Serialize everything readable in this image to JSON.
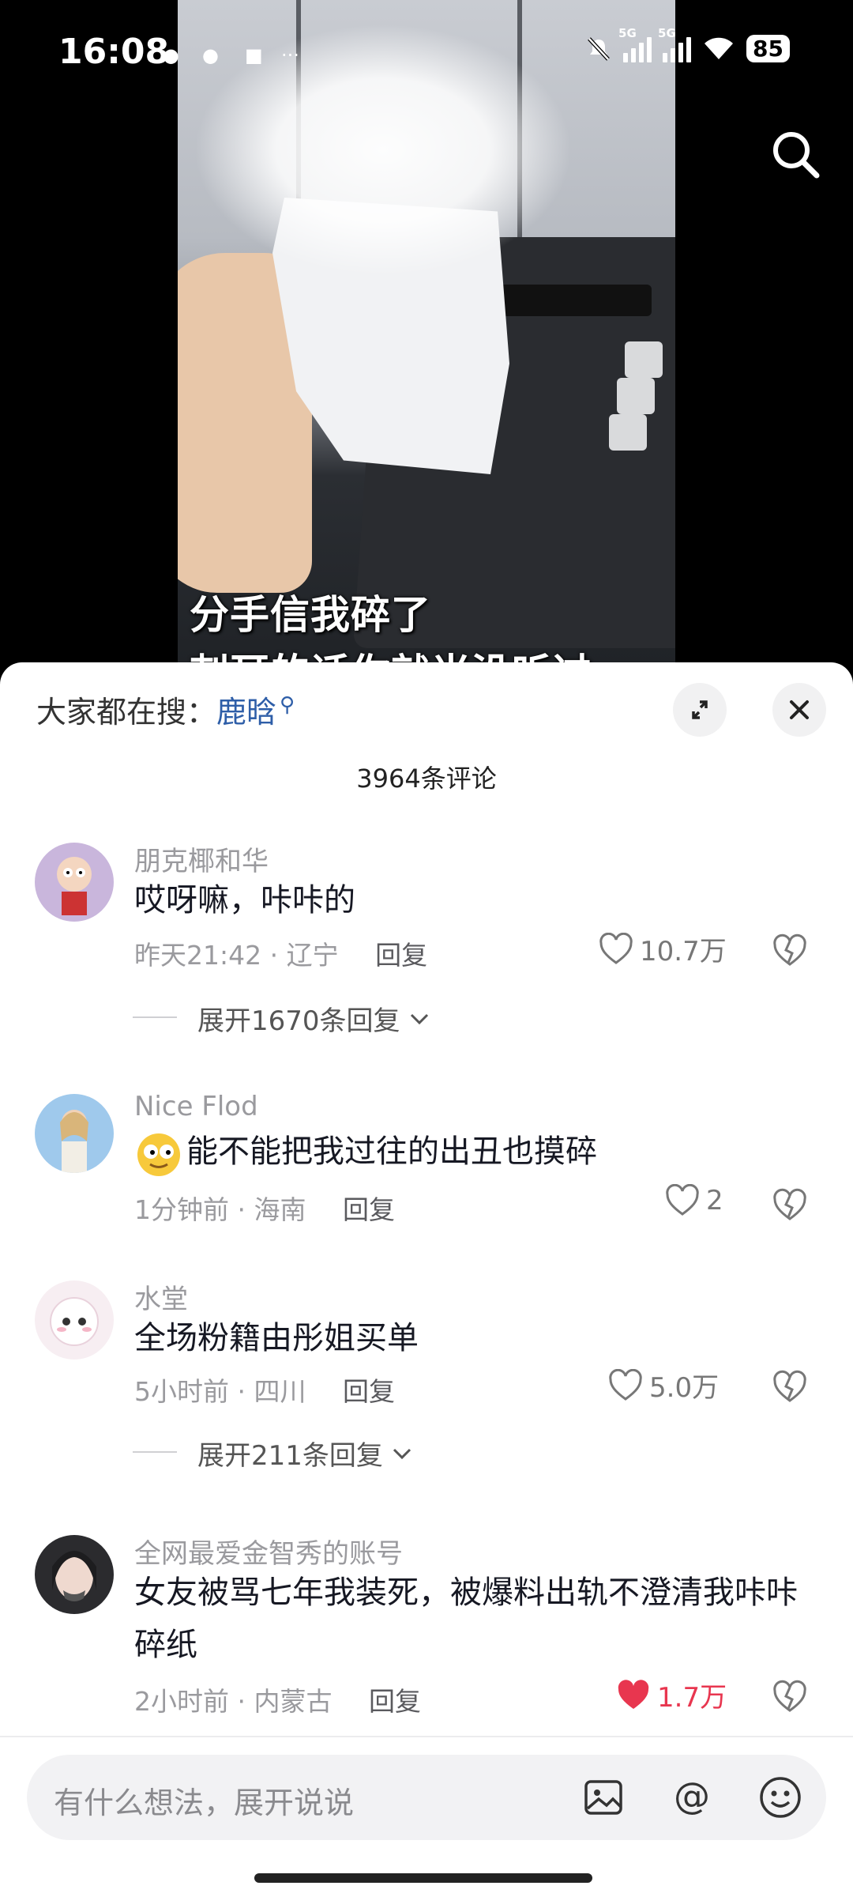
{
  "status": {
    "time": "16:08",
    "network_tag": "5G",
    "battery": "85"
  },
  "video": {
    "subtitle_line1": "分手信我碎了",
    "subtitle_line2": "刺耳的话你就当没听过"
  },
  "sheet": {
    "trending_label": "大家都在搜：",
    "trending_query": "鹿晗",
    "comment_count": "3964条评论"
  },
  "comments": [
    {
      "user": "朋克椰和华",
      "text": "哎呀嘛，咔咔的",
      "time": "昨天21:42",
      "location": "辽宁",
      "reply_label": "回复",
      "likes": "10.7万",
      "liked": false,
      "expand": "展开1670条回复"
    },
    {
      "user": "Nice Flod",
      "text": "能不能把我过往的出丑也摸碎",
      "time": "1分钟前",
      "location": "海南",
      "reply_label": "回复",
      "likes": "2",
      "liked": false
    },
    {
      "user": "水堂",
      "text": "全场粉籍由彤姐买单",
      "time": "5小时前",
      "location": "四川",
      "reply_label": "回复",
      "likes": "5.0万",
      "liked": false,
      "expand": "展开211条回复"
    },
    {
      "user": "全网最爱金智秀的账号",
      "text": "女友被骂七年我装死，被爆料出轨不澄清我咔咔碎纸",
      "time": "2小时前",
      "location": "内蒙古",
      "reply_label": "回复",
      "likes": "1.7万",
      "liked": true
    }
  ],
  "input": {
    "placeholder": "有什么想法，展开说说"
  },
  "colors": {
    "like_active": "#e8364f",
    "link_blue": "#2e5ea8",
    "meta_gray": "#9a9a9e"
  }
}
